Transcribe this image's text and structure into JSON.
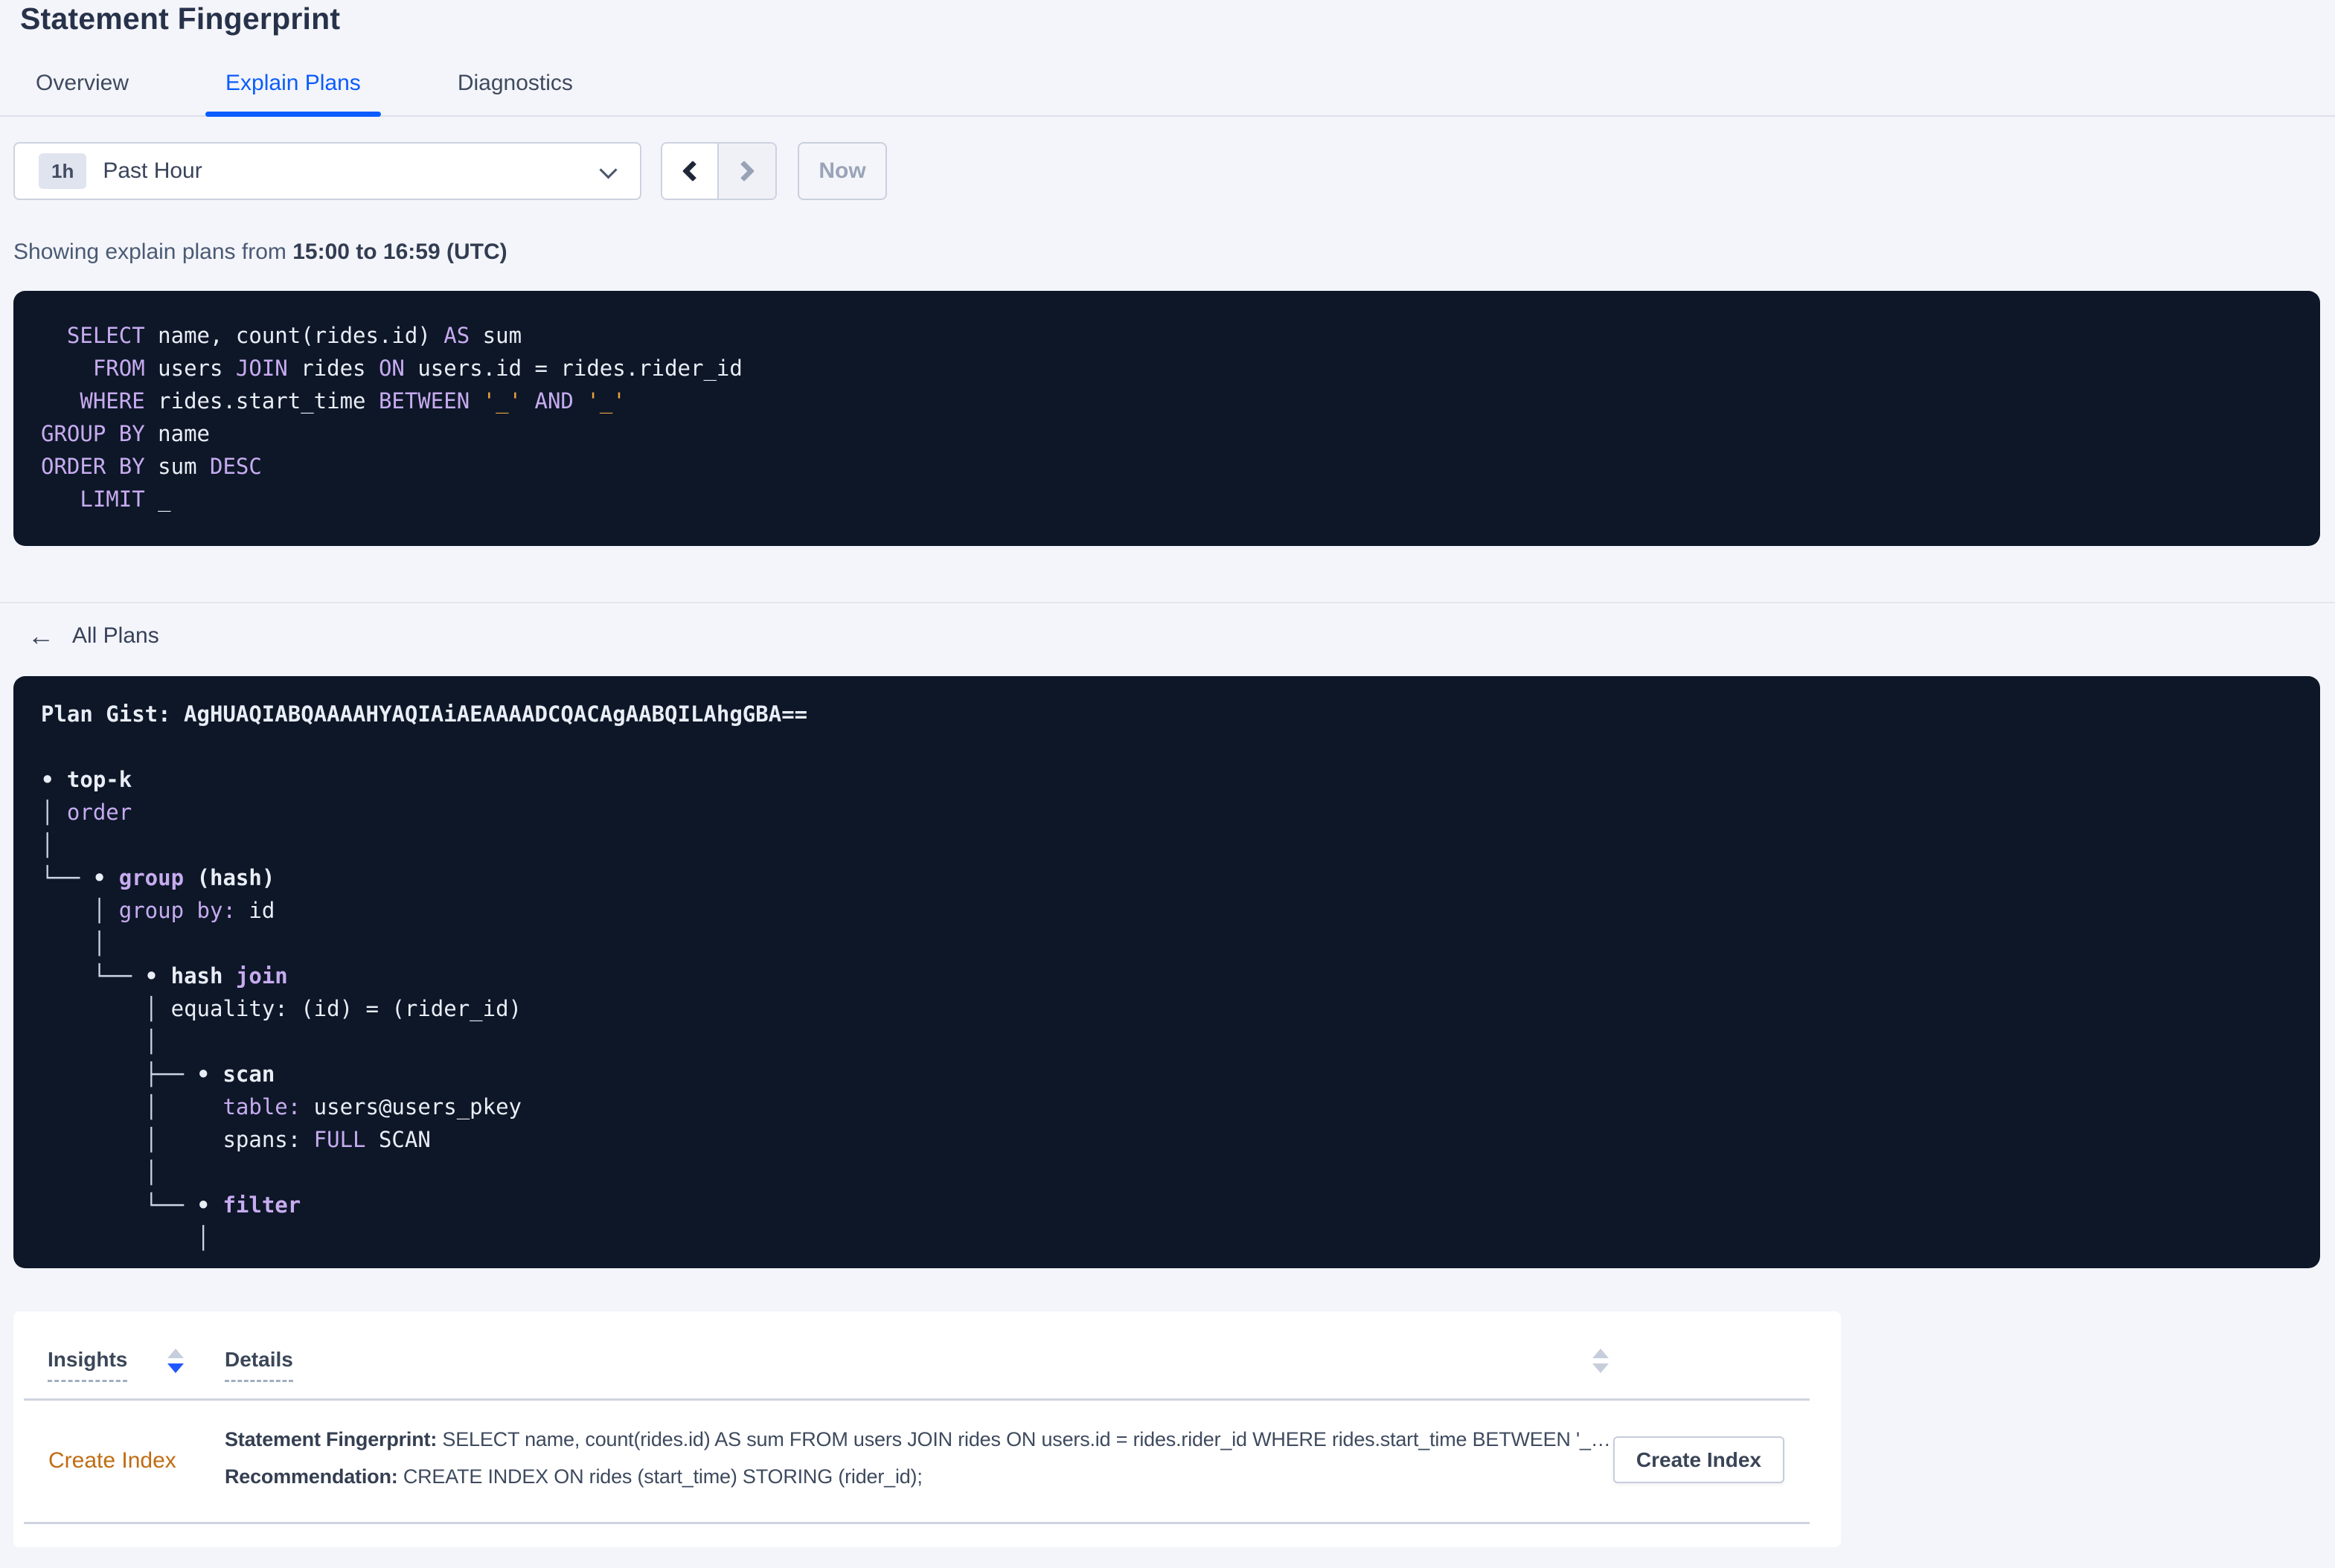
{
  "page": {
    "title": "Statement Fingerprint"
  },
  "tabs": [
    {
      "label": "Overview"
    },
    {
      "label": "Explain Plans"
    },
    {
      "label": "Diagnostics"
    }
  ],
  "time_picker": {
    "badge": "1h",
    "label": "Past Hour"
  },
  "pager": {
    "now_label": "Now"
  },
  "summary": {
    "prefix": "Showing explain plans from",
    "range": "15:00 to 16:59 (UTC)"
  },
  "sql": {
    "lines": [
      [
        [
          "k",
          "  SELECT"
        ],
        [
          "w",
          " name, count(rides.id) "
        ],
        [
          "k",
          "AS"
        ],
        [
          "w",
          " sum"
        ]
      ],
      [
        [
          "k",
          "    FROM"
        ],
        [
          "w",
          " users "
        ],
        [
          "k",
          "JOIN"
        ],
        [
          "w",
          " rides "
        ],
        [
          "k",
          "ON"
        ],
        [
          "w",
          " users.id = rides.rider_id"
        ]
      ],
      [
        [
          "k",
          "   WHERE"
        ],
        [
          "w",
          " rides.start_time "
        ],
        [
          "k",
          "BETWEEN"
        ],
        [
          "w",
          " "
        ],
        [
          "o",
          "'_'"
        ],
        [
          "w",
          " "
        ],
        [
          "k",
          "AND"
        ],
        [
          "w",
          " "
        ],
        [
          "o",
          "'_'"
        ]
      ],
      [
        [
          "k",
          "GROUP BY"
        ],
        [
          "w",
          " name"
        ]
      ],
      [
        [
          "k",
          "ORDER BY"
        ],
        [
          "w",
          " sum "
        ],
        [
          "k",
          "DESC"
        ]
      ],
      [
        [
          "k",
          "   LIMIT"
        ],
        [
          "w",
          " _"
        ]
      ]
    ]
  },
  "all_plans": {
    "label": "All Plans",
    "arrow": "←"
  },
  "plan": {
    "gist_line": "Plan Gist: AgHUAQIABQAAAAHYAQIAiAEAAAADCQACAgAABQILAhgGBA==",
    "tree": [
      [
        [
          "b",
          "• top-k"
        ]
      ],
      [
        [
          "c",
          "│ "
        ],
        [
          "k",
          "order"
        ]
      ],
      [
        [
          "c",
          "│"
        ]
      ],
      [
        [
          "c",
          "└── "
        ],
        [
          "b",
          "• "
        ],
        [
          "p",
          "group "
        ],
        [
          "b",
          "(hash)"
        ]
      ],
      [
        [
          "c",
          "    │ "
        ],
        [
          "k",
          "group by:"
        ],
        [
          "w",
          " id"
        ]
      ],
      [
        [
          "c",
          "    │"
        ]
      ],
      [
        [
          "c",
          "    └── "
        ],
        [
          "b",
          "• hash "
        ],
        [
          "p",
          "join"
        ]
      ],
      [
        [
          "c",
          "        │ "
        ],
        [
          "w",
          "equality: (id) = (rider_id)"
        ]
      ],
      [
        [
          "c",
          "        │"
        ]
      ],
      [
        [
          "c",
          "        ├── "
        ],
        [
          "b",
          "• scan"
        ]
      ],
      [
        [
          "c",
          "        │     "
        ],
        [
          "k",
          "table:"
        ],
        [
          "w",
          " users@users_pkey"
        ]
      ],
      [
        [
          "c",
          "        │     "
        ],
        [
          "w",
          "spans: "
        ],
        [
          "k",
          "FULL"
        ],
        [
          "w",
          " SCAN"
        ]
      ],
      [
        [
          "c",
          "        │"
        ]
      ],
      [
        [
          "c",
          "        └── "
        ],
        [
          "b",
          "• "
        ],
        [
          "p",
          "filter"
        ]
      ],
      [
        [
          "c",
          "            │"
        ]
      ]
    ]
  },
  "insights_table": {
    "columns": {
      "insights": "Insights",
      "details": "Details"
    },
    "row": {
      "insight": "Create Index",
      "fingerprint_label": "Statement Fingerprint:",
      "fingerprint": " SELECT name, count(rides.id) AS sum FROM users JOIN rides ON users.id = rides.rider_id WHERE rides.start_time BETWEEN '_…",
      "recommendation_label": "Recommendation:",
      "recommendation": " CREATE INDEX ON rides (start_time) STORING (rider_id);",
      "action": "Create Index"
    }
  },
  "colors": {
    "accent_blue": "#0a5cff",
    "code_background": "#0d1728",
    "keyword_purple": "#c7abef",
    "literal_orange": "#eda43c",
    "insight_link_orange": "#c06c12",
    "page_background": "#f4f5fa"
  }
}
